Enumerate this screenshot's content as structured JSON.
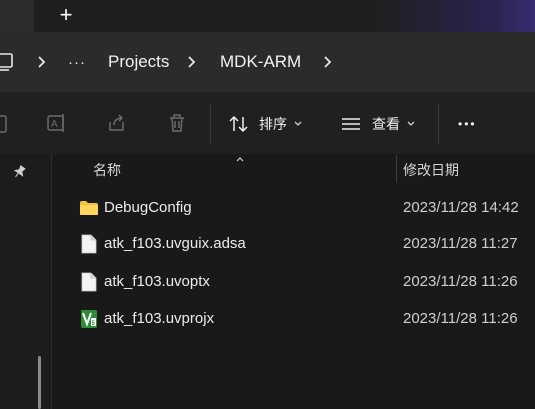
{
  "titlebar": {
    "new_tab_label": "+"
  },
  "address": {
    "breadcrumbs": [
      "Projects",
      "MDK-ARM"
    ],
    "more_label": "···",
    "chevron": "›"
  },
  "toolbar": {
    "sort_label": "排序",
    "view_label": "查看",
    "more_label": "•••"
  },
  "columns": {
    "name": "名称",
    "modified": "修改日期"
  },
  "files": [
    {
      "name": "DebugConfig",
      "date": "2023/11/28 14:42",
      "icon": "folder-icon"
    },
    {
      "name": "atk_f103.uvguix.adsa",
      "date": "2023/11/28 11:27",
      "icon": "file-icon"
    },
    {
      "name": "atk_f103.uvoptx",
      "date": "2023/11/28 11:26",
      "icon": "file-icon"
    },
    {
      "name": "atk_f103.uvprojx",
      "date": "2023/11/28 11:26",
      "icon": "keil-project-icon"
    }
  ],
  "colors": {
    "folder": "#f5c342",
    "accent": "#3a2c70",
    "keil": "#2e8b3a"
  }
}
